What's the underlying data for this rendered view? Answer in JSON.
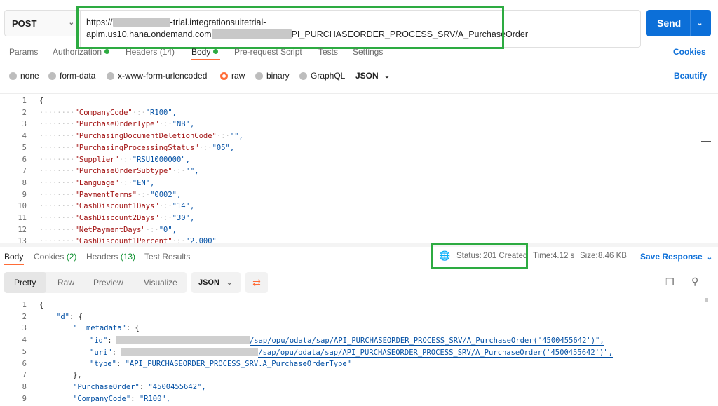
{
  "request": {
    "method": "POST",
    "url_line1_prefix": "https://",
    "url_line1_suffix": "-trial.integrationsuitetrial-",
    "url_line2_prefix": "apim.us10.hana.ondemand.com",
    "url_line2_suffix": "PI_PURCHASEORDER_PROCESS_SRV/A_PurchaseOrder",
    "send_label": "Send"
  },
  "request_tabs": [
    {
      "label": "Params"
    },
    {
      "label": "Authorization"
    },
    {
      "label": "Headers (14)"
    },
    {
      "label": "Body"
    },
    {
      "label": "Pre-request Script"
    },
    {
      "label": "Tests"
    },
    {
      "label": "Settings"
    }
  ],
  "cookies_label": "Cookies",
  "body_types": [
    "none",
    "form-data",
    "x-www-form-urlencoded",
    "raw",
    "binary",
    "GraphQL"
  ],
  "body_format": "JSON",
  "beautify_label": "Beautify",
  "request_body_lines": [
    {
      "n": "1",
      "text": "{"
    },
    {
      "n": "2",
      "key": "\"CompanyCode\"",
      "val": "\"R100\","
    },
    {
      "n": "3",
      "key": "\"PurchaseOrderType\"",
      "val": "\"NB\","
    },
    {
      "n": "4",
      "key": "\"PurchasingDocumentDeletionCode\"",
      "val": "\"\","
    },
    {
      "n": "5",
      "key": "\"PurchasingProcessingStatus\"",
      "val": "\"05\","
    },
    {
      "n": "6",
      "key": "\"Supplier\"",
      "val": "\"RSU1000000\","
    },
    {
      "n": "7",
      "key": "\"PurchaseOrderSubtype\"",
      "val": "\"\","
    },
    {
      "n": "8",
      "key": "\"Language\"",
      "val": "\"EN\","
    },
    {
      "n": "9",
      "key": "\"PaymentTerms\"",
      "val": "\"0002\","
    },
    {
      "n": "10",
      "key": "\"CashDiscount1Days\"",
      "val": "\"14\","
    },
    {
      "n": "11",
      "key": "\"CashDiscount2Days\"",
      "val": "\"30\","
    },
    {
      "n": "12",
      "key": "\"NetPaymentDays\"",
      "val": "\"0\","
    },
    {
      "n": "13",
      "key": "\"CashDiscount1Percent\"",
      "val": "\"2.000\""
    }
  ],
  "response_tabs": [
    {
      "label": "Body"
    },
    {
      "label": "Cookies",
      "count": "(2)"
    },
    {
      "label": "Headers",
      "count": "(13)"
    },
    {
      "label": "Test Results"
    }
  ],
  "response_meta": {
    "status_label": "Status:",
    "status_value": "201 Created",
    "time_label": "Time:",
    "time_value": "4.12 s",
    "size_label": "Size:",
    "size_value": "8.46 KB",
    "save_label": "Save Response"
  },
  "view_tabs": [
    "Pretty",
    "Raw",
    "Preview",
    "Visualize"
  ],
  "response_format": "JSON",
  "response_lines": {
    "l1": "{",
    "l2_key": "\"d\"",
    "l2_rest": ": {",
    "l3_key": "\"__metadata\"",
    "l3_rest": ": {",
    "l4_key": "\"id\"",
    "l4_val": "/sap/opu/odata/sap/API_PURCHASEORDER_PROCESS_SRV/A_PurchaseOrder('4500455642')\",",
    "l5_key": "\"uri\"",
    "l5_val": "/sap/opu/odata/sap/API_PURCHASEORDER_PROCESS_SRV/A_PurchaseOrder('4500455642')\",",
    "l6_key": "\"type\"",
    "l6_val": "\"API_PURCHASEORDER_PROCESS_SRV.A_PurchaseOrderType\"",
    "l7": "},",
    "l8_key": "\"PurchaseOrder\"",
    "l8_val": "\"4500455642\",",
    "l9_key": "\"CompanyCode\"",
    "l9_val": "\"R100\","
  },
  "response_line_numbers": [
    "1",
    "2",
    "3",
    "4",
    "5",
    "6",
    "7",
    "8",
    "9"
  ]
}
